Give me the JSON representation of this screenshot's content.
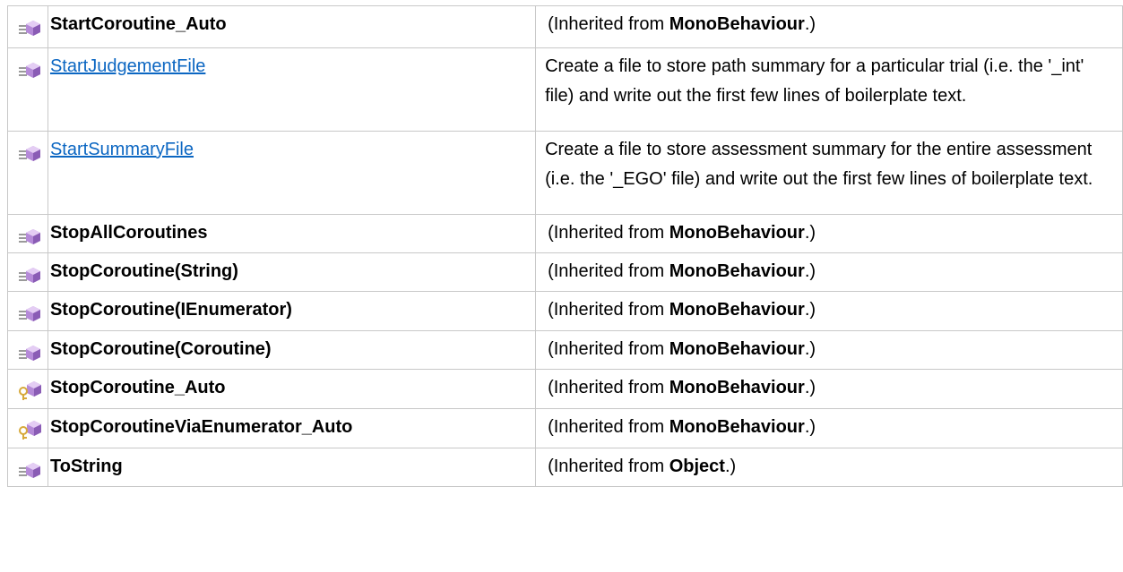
{
  "inherited_prefix": "(Inherited from ",
  "inherited_suffix": ".)",
  "rows": [
    {
      "name": "StartCoroutine_Auto",
      "link": false,
      "icon": "public-method-icon",
      "desc_type": "inherited",
      "from": "MonoBehaviour"
    },
    {
      "name": "StartJudgementFile",
      "link": true,
      "icon": "public-method-icon",
      "desc_type": "text",
      "desc": "Create a file to store path summary for a particular trial (i.e. the '_int' file) and write out the first few lines of boilerplate text."
    },
    {
      "name": "StartSummaryFile",
      "link": true,
      "icon": "public-method-icon",
      "desc_type": "text",
      "desc": "Create a file to store assessment summary for the entire assessment (i.e. the '_EGO' file) and write out the first few lines of boilerplate text."
    },
    {
      "name": "StopAllCoroutines",
      "link": false,
      "icon": "public-method-icon",
      "desc_type": "inherited",
      "from": "MonoBehaviour"
    },
    {
      "name": "StopCoroutine(String)",
      "link": false,
      "icon": "public-method-icon",
      "desc_type": "inherited",
      "from": "MonoBehaviour"
    },
    {
      "name": "StopCoroutine(IEnumerator)",
      "link": false,
      "icon": "public-method-icon",
      "desc_type": "inherited",
      "from": "MonoBehaviour"
    },
    {
      "name": "StopCoroutine(Coroutine)",
      "link": false,
      "icon": "public-method-icon",
      "desc_type": "inherited",
      "from": "MonoBehaviour"
    },
    {
      "name": "StopCoroutine_Auto",
      "link": false,
      "icon": "internal-method-icon",
      "desc_type": "inherited",
      "from": "MonoBehaviour"
    },
    {
      "name": "StopCoroutineViaEnumerator_Auto",
      "link": false,
      "icon": "internal-method-icon",
      "desc_type": "inherited",
      "from": "MonoBehaviour"
    },
    {
      "name": "ToString",
      "link": false,
      "icon": "public-method-icon",
      "desc_type": "inherited",
      "from": "Object"
    }
  ],
  "colors": {
    "link": "#0b66c2",
    "border": "#c8c8c8",
    "cube_purple": "#b58ad8",
    "cube_purple_dark": "#8a5cb5",
    "key_gold": "#d7a93a"
  }
}
